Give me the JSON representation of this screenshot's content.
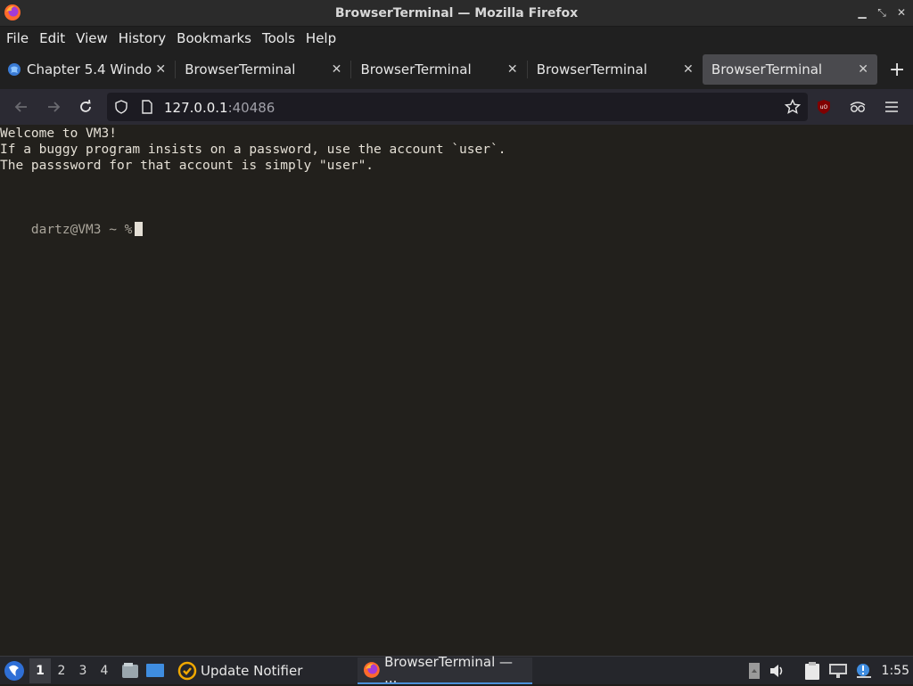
{
  "window": {
    "title": "BrowserTerminal — Mozilla Firefox",
    "controls": [
      "minimize-icon",
      "restore-icon",
      "close-icon"
    ]
  },
  "menu": {
    "items": [
      "File",
      "Edit",
      "View",
      "History",
      "Bookmarks",
      "Tools",
      "Help"
    ]
  },
  "tabs": [
    {
      "label": "Chapter 5.4 Windo",
      "active": false,
      "favicon": "globe-icon"
    },
    {
      "label": "BrowserTerminal",
      "active": false
    },
    {
      "label": "BrowserTerminal",
      "active": false
    },
    {
      "label": "BrowserTerminal",
      "active": false
    },
    {
      "label": "BrowserTerminal",
      "active": true
    }
  ],
  "nav": {
    "url_host": "127.0.0.1",
    "url_port": ":40486"
  },
  "terminal": {
    "lines": [
      "Welcome to VM3!",
      "If a buggy program insists on a password, use the account `user`.",
      "The passsword for that account is simply \"user\"."
    ],
    "prompt": "dartz@VM3 ~ %"
  },
  "taskbar": {
    "workspaces": [
      "1",
      "2",
      "3",
      "4"
    ],
    "active_workspace": "1",
    "tasks": [
      {
        "label": "Update Notifier",
        "icon": "update-notifier-icon"
      },
      {
        "label": "BrowserTerminal — ...",
        "icon": "firefox-icon",
        "active": true
      }
    ],
    "clock": "1:55"
  },
  "colors": {
    "terminal_bg": "#22201c",
    "terminal_fg": "#e4dfd5",
    "accent": "#4a90d9"
  }
}
